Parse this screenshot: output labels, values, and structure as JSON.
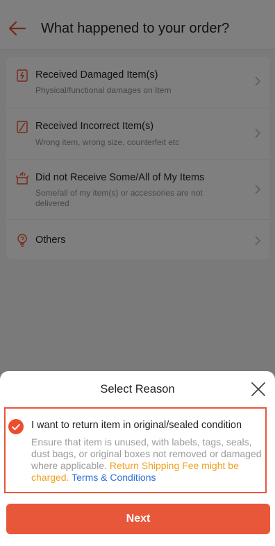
{
  "header": {
    "title": "What happened to your order?"
  },
  "reasons": [
    {
      "title": "Received Damaged Item(s)",
      "subtitle": "Physical/functional damages on Item",
      "icon": "damaged-box-icon"
    },
    {
      "title": "Received Incorrect Item(s)",
      "subtitle": "Wrong item, wrong size, counterfeit etc",
      "icon": "incorrect-item-icon"
    },
    {
      "title": "Did not Receive Some/All of My Items",
      "subtitle": "Some/all of my item(s) or accessories are not delivered",
      "icon": "open-box-icon"
    },
    {
      "title": "Others",
      "subtitle": "",
      "icon": "help-bulb-icon"
    }
  ],
  "sheet": {
    "title": "Select Reason",
    "option": {
      "title": "I want to return item in original/sealed condition",
      "desc": "Ensure that item is unused, with labels, tags, seals, dust bags, or original boxes not removed or damaged where applicable.",
      "warning": "Return Shipping Fee might be charged.",
      "link": "Terms & Conditions"
    },
    "next_label": "Next"
  },
  "colors": {
    "accent": "#ee4d2d",
    "warning": "#f0a020",
    "link": "#2f6fd6"
  }
}
